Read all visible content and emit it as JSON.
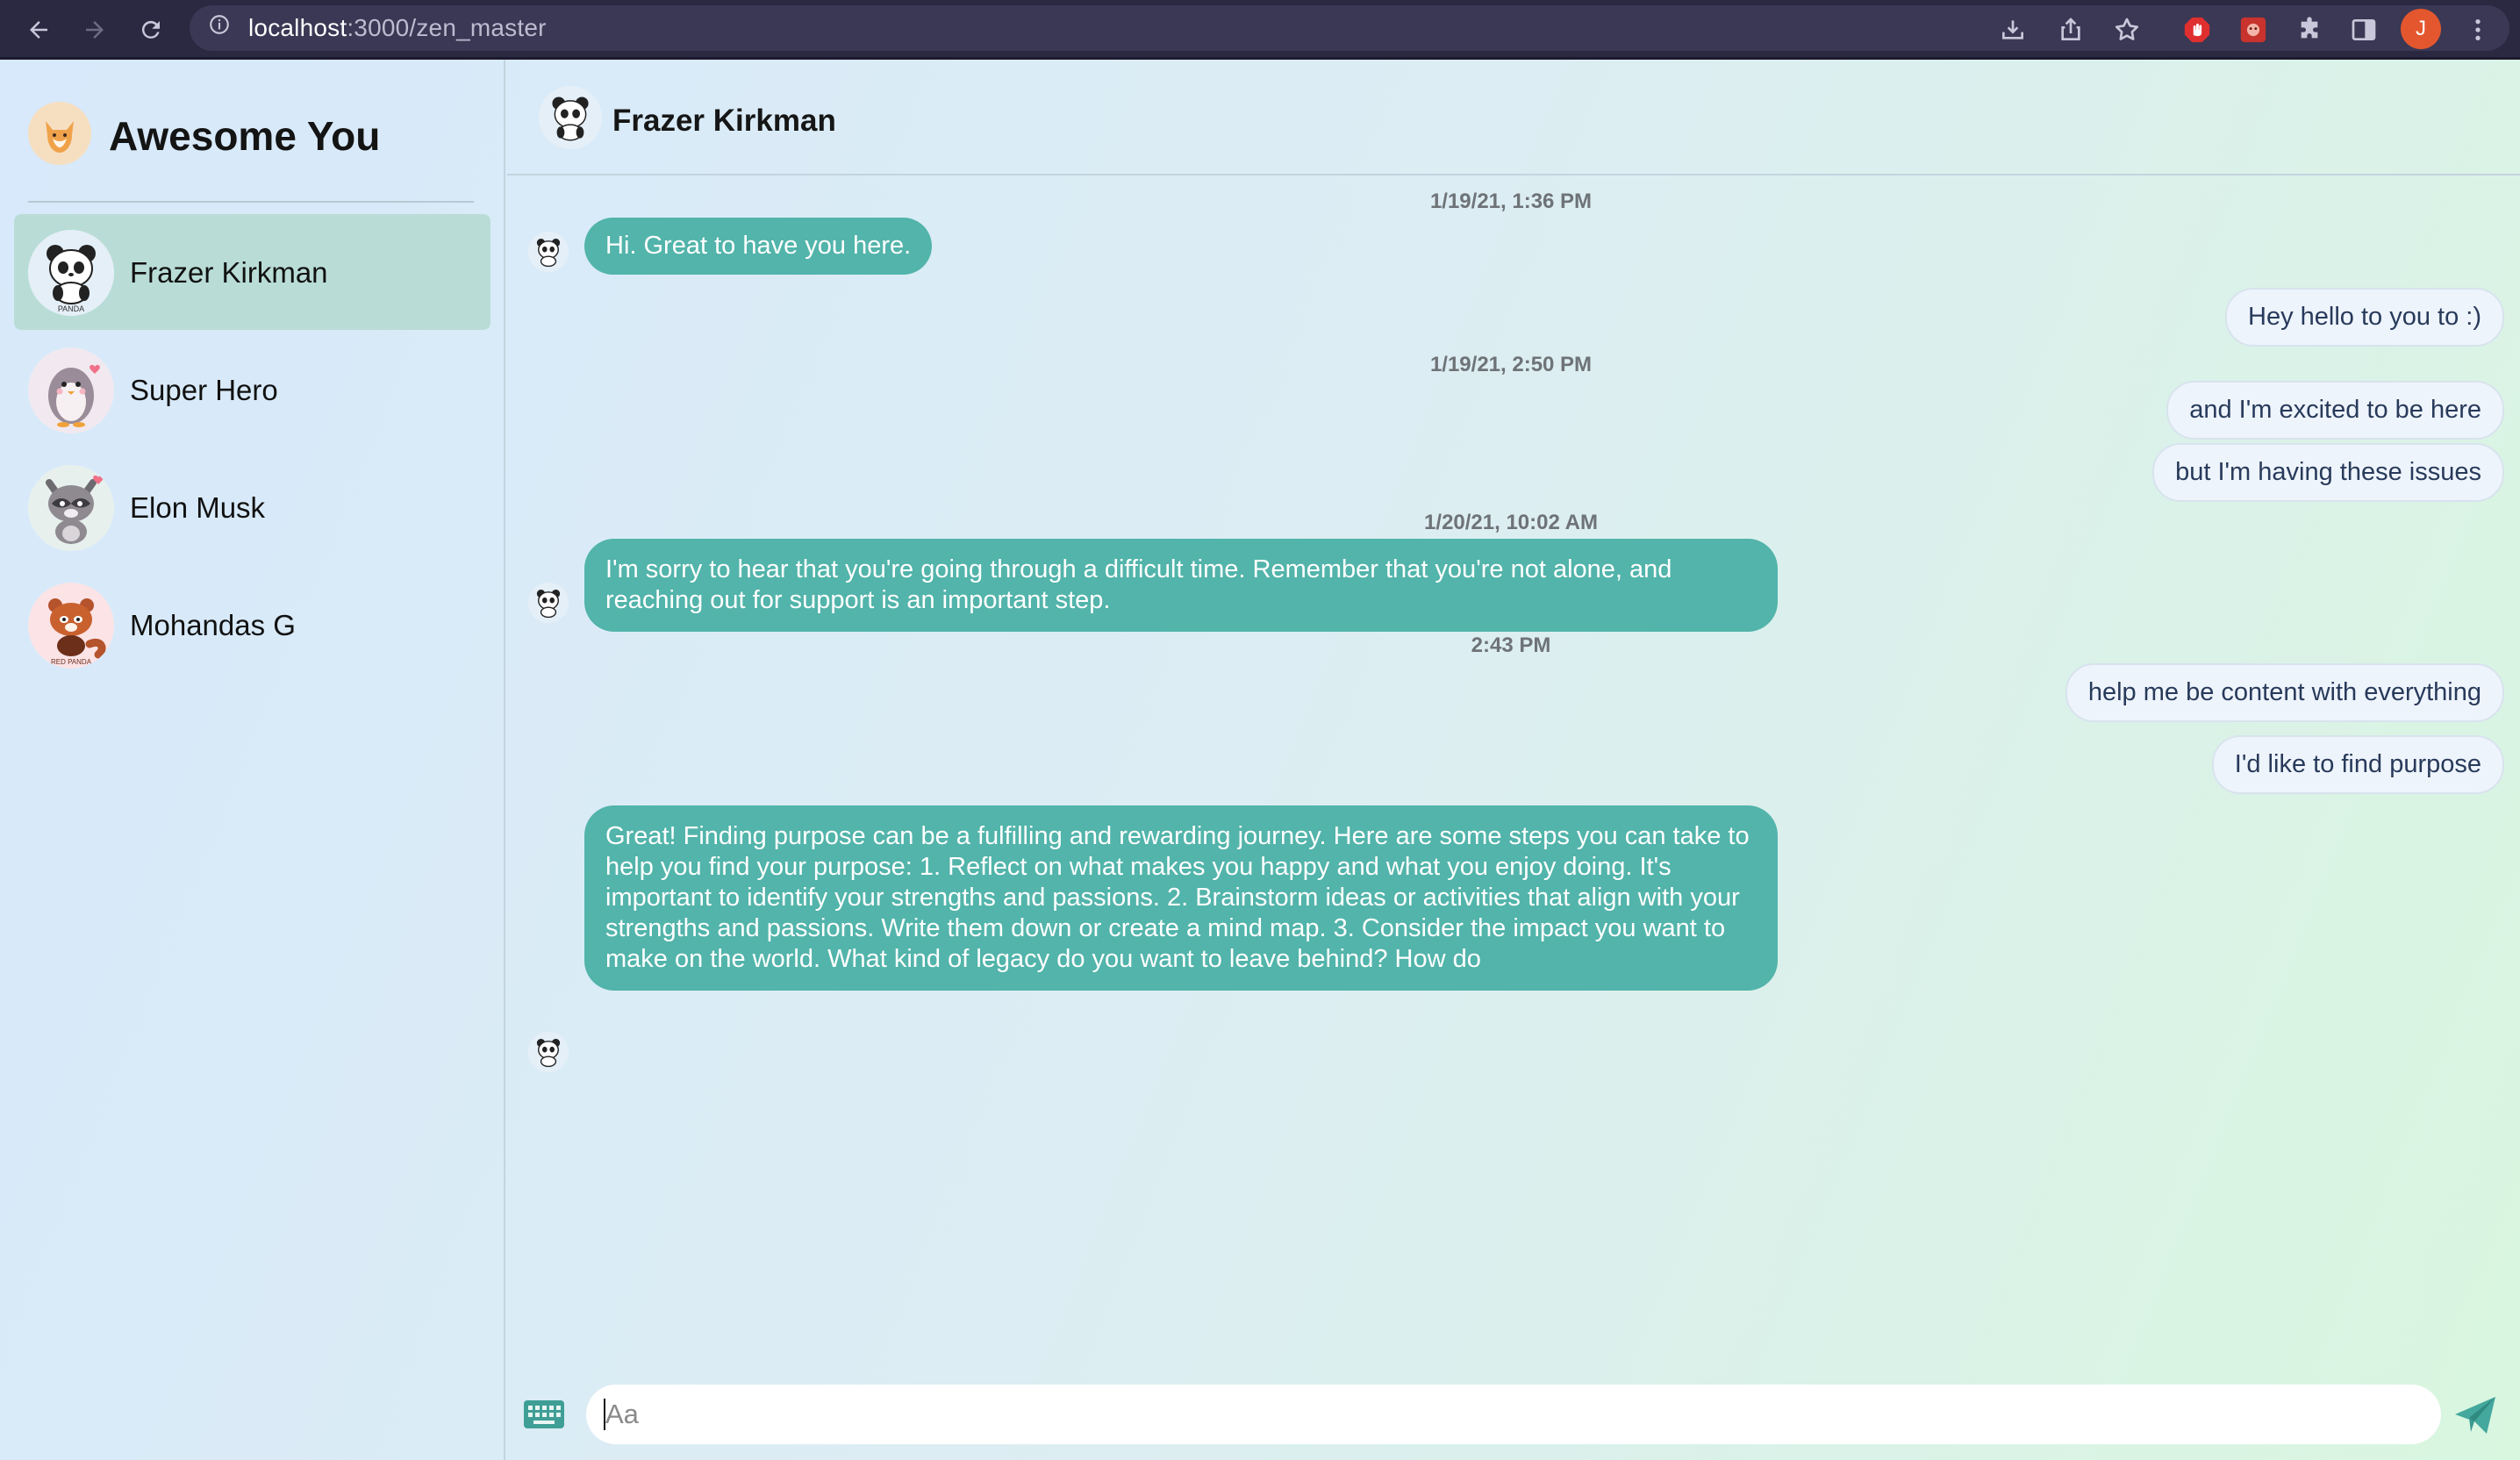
{
  "browser": {
    "url_host": "localhost",
    "url_path": ":3000/zen_master",
    "profile_initial": "J",
    "icons": [
      "back-arrow-icon",
      "forward-arrow-icon",
      "reload-icon",
      "info-icon",
      "download-icon",
      "share-icon",
      "star-icon",
      "adblock-extension-icon",
      "extension-icon",
      "puzzle-extensions-icon",
      "sidebar-icon",
      "kebab-menu-icon"
    ]
  },
  "sidebar": {
    "title": "Awesome You",
    "contacts": [
      {
        "name": "Frazer Kirkman",
        "avatar": "panda-avatar",
        "active": true
      },
      {
        "name": "Super Hero",
        "avatar": "penguin-avatar",
        "active": false
      },
      {
        "name": "Elon Musk",
        "avatar": "raccoon-avatar",
        "active": false
      },
      {
        "name": "Mohandas G",
        "avatar": "red-panda-avatar",
        "active": false
      }
    ],
    "avatar_labels": {
      "panda": "PANDA",
      "red_panda": "RED PANDA"
    }
  },
  "chat": {
    "header_name": "Frazer Kirkman",
    "timestamps": [
      "1/19/21, 1:36 PM",
      "1/19/21, 2:50 PM",
      "1/20/21, 10:02 AM",
      "2:43 PM"
    ],
    "messages": [
      {
        "from": "bot",
        "text": "Hi. Great to have you here."
      },
      {
        "from": "user",
        "text": "Hey hello to you to :)"
      },
      {
        "from": "user",
        "text": "and I'm excited to be here"
      },
      {
        "from": "user",
        "text": "but I'm having these issues"
      },
      {
        "from": "bot",
        "text": "I'm sorry to hear that you're going through a difficult time. Remember that you're not alone, and reaching out for support is an important step."
      },
      {
        "from": "user",
        "text": "help me be content with everything"
      },
      {
        "from": "user",
        "text": "I'd like to find purpose"
      },
      {
        "from": "bot",
        "text": "Great! Finding purpose can be a fulfilling and rewarding journey. Here are some steps you can take to help you find your purpose: 1. Reflect on what makes you happy and what you enjoy doing. It's important to identify your strengths and passions. 2. Brainstorm ideas or activities that align with your strengths and passions. Write them down or create a mind map. 3. Consider the impact you want to make on the world. What kind of legacy do you want to leave behind? How do"
      }
    ],
    "composer": {
      "placeholder": "Aa",
      "value": ""
    }
  },
  "colors": {
    "bot_bubble": "#52b4aa",
    "user_bubble": "#eef4fb",
    "user_text": "#283a5b",
    "active_contact": "#b9ddd6"
  }
}
